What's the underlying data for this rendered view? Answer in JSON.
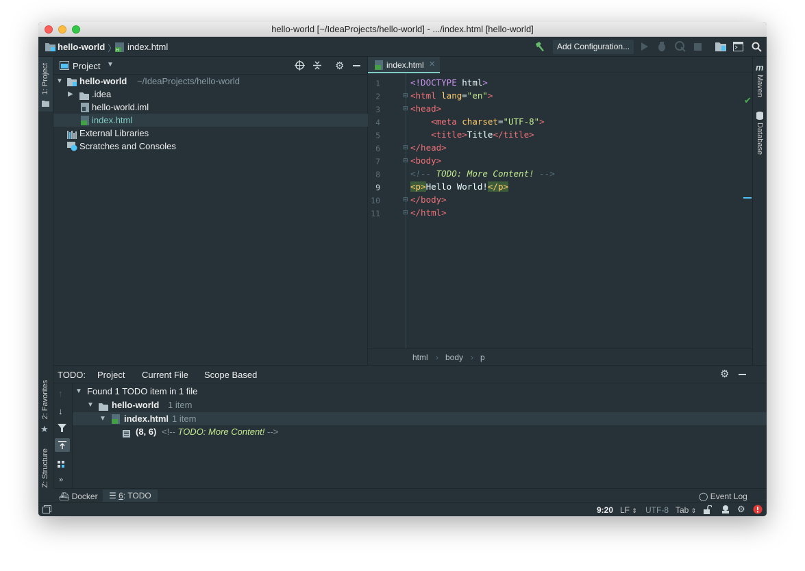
{
  "window": {
    "title": "hello-world [~/IdeaProjects/hello-world] - .../index.html [hello-world]"
  },
  "navbar": {
    "project": "hello-world",
    "file": "index.html",
    "run_config": "Add Configuration..."
  },
  "left_tools": {
    "project": "1: Project",
    "favorites": "2: Favorites",
    "structure": "Z: Structure"
  },
  "right_tools": {
    "maven": "Maven",
    "database": "Database",
    "maven_glyph": "m"
  },
  "project_panel": {
    "title": "Project",
    "tree": [
      {
        "label": "hello-world",
        "extra": "~/IdeaProjects/hello-world"
      },
      {
        "label": ".idea"
      },
      {
        "label": "hello-world.iml"
      },
      {
        "label": "index.html"
      },
      {
        "label": "External Libraries"
      },
      {
        "label": "Scratches and Consoles"
      }
    ]
  },
  "editor": {
    "tab": "index.html",
    "line_numbers": [
      "1",
      "2",
      "3",
      "4",
      "5",
      "6",
      "7",
      "8",
      "9",
      "10",
      "11"
    ],
    "current_line": "9",
    "breadcrumb": [
      "html",
      "body",
      "p"
    ]
  },
  "todo": {
    "label": "TODO:",
    "tabs": [
      "Project",
      "Current File",
      "Scope Based"
    ],
    "summary": "Found 1 TODO item in 1 file",
    "project": {
      "name": "hello-world",
      "count": "1 item"
    },
    "file": {
      "name": "index.html",
      "count": "1 item"
    },
    "item": {
      "pos": "(8, 6)",
      "pre": "<!-- ",
      "text": "TODO: More Content!",
      "post": " -->"
    }
  },
  "bottom_tabs": {
    "docker": "Docker",
    "todo_num": "6",
    "todo_label": ": TODO",
    "event_log": "Event Log"
  },
  "status": {
    "position": "9:20",
    "line_sep": "LF",
    "encoding": "UTF-8",
    "indent": "Tab"
  },
  "colors": {
    "background": "#263238",
    "accent": "#80cbc4",
    "tag": "#f07178",
    "string": "#c3e88d",
    "attr": "#ffcb6b",
    "comment": "#546e7a"
  }
}
